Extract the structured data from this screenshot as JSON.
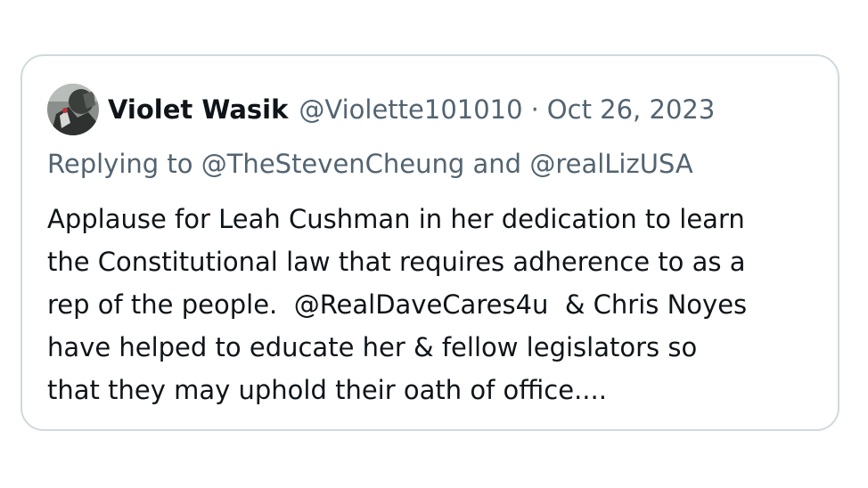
{
  "tweet": {
    "author_name": "Violet Wasik",
    "author_handle": "@Violette101010",
    "separator": "·",
    "date": "Oct 26, 2023",
    "avatar_icon": "profile-photo",
    "reply": {
      "prefix": "Replying to",
      "mention_1": "@TheStevenCheung",
      "conjunction": "and",
      "mention_2": "@realLizUSA"
    },
    "body_lines": [
      "Applause for Leah Cushman in her dedication to learn",
      "the Constitutional law that requires adherence to as a",
      "rep of the people.  @RealDaveCares4u  & Chris Noyes",
      "have helped to educate her & fellow legislators so",
      "that they may uphold their oath of office...."
    ]
  },
  "colors": {
    "text_primary": "#0f1419",
    "text_secondary": "#536471",
    "border": "#cfd9de"
  }
}
